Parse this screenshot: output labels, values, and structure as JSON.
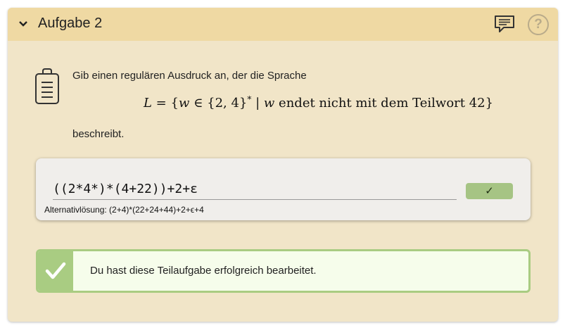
{
  "exercise": {
    "title": "Aufgabe 2",
    "collapse_icon": "chevron-down-icon",
    "comment_icon": "comment-icon",
    "help_icon": "help-icon",
    "help_symbol": "?"
  },
  "task": {
    "icon": "clipboard-icon",
    "intro": "Gib einen regulären Ausdruck an, der die Sprache",
    "formula_parts": {
      "lhs": "L",
      "eq": " = {",
      "var1": "w",
      "in": " ∈ {2, 4}",
      "star": "*",
      "bar": " | ",
      "var2": "w",
      "rest": " endet nicht mit dem Teilwort 42}"
    },
    "suffix": "beschreibt."
  },
  "answer": {
    "value": "((2*4*)*(4+22))+2+ε",
    "check_label": "✓",
    "alternative": "Alternativlösung: (2+4)*(22+24+44)+2+ϵ+4"
  },
  "feedback": {
    "icon": "checkmark-icon",
    "message": "Du hast diese Teilaufgabe erfolgreich bearbeitet."
  },
  "colors": {
    "header_bg": "#efd9a3",
    "panel_bg": "#f1e5c8",
    "success_green": "#a9cc82",
    "success_bg": "#f6fdeb",
    "button_green": "#a6c484"
  }
}
